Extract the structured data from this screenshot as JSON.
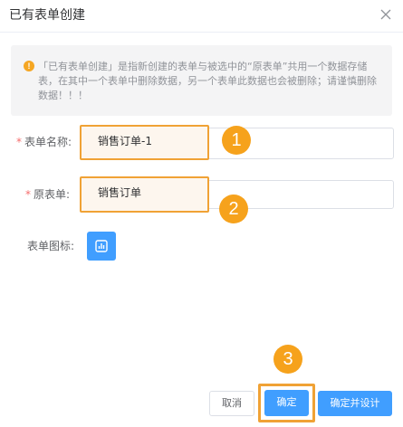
{
  "dialog": {
    "title": "已有表单创建",
    "close_icon": "close-icon"
  },
  "notice": {
    "icon": "warning-icon",
    "icon_glyph": "!",
    "text": "「已有表单创建」是指新创建的表单与被选中的“原表单”共用一个数据存储表，在其中一个表单中删除数据，另一个表单此数据也会被删除；请谨慎删除数据！！！"
  },
  "form": {
    "required_mark": "*",
    "name_label": "表单名称:",
    "name_value": "销售订单-1",
    "source_label": "原表单:",
    "source_value": "销售订单",
    "icon_label": "表单图标:",
    "icon_button": "chart-icon"
  },
  "steps": [
    "1",
    "2",
    "3"
  ],
  "footer": {
    "cancel_label": "取消",
    "confirm_label": "确定",
    "confirm_design_label": "确定并设计"
  },
  "colors": {
    "primary": "#409eff",
    "highlight": "#f0a235",
    "step_badge": "#f6a21c",
    "required": "#f56c6c",
    "notice_icon": "#f5a623"
  }
}
